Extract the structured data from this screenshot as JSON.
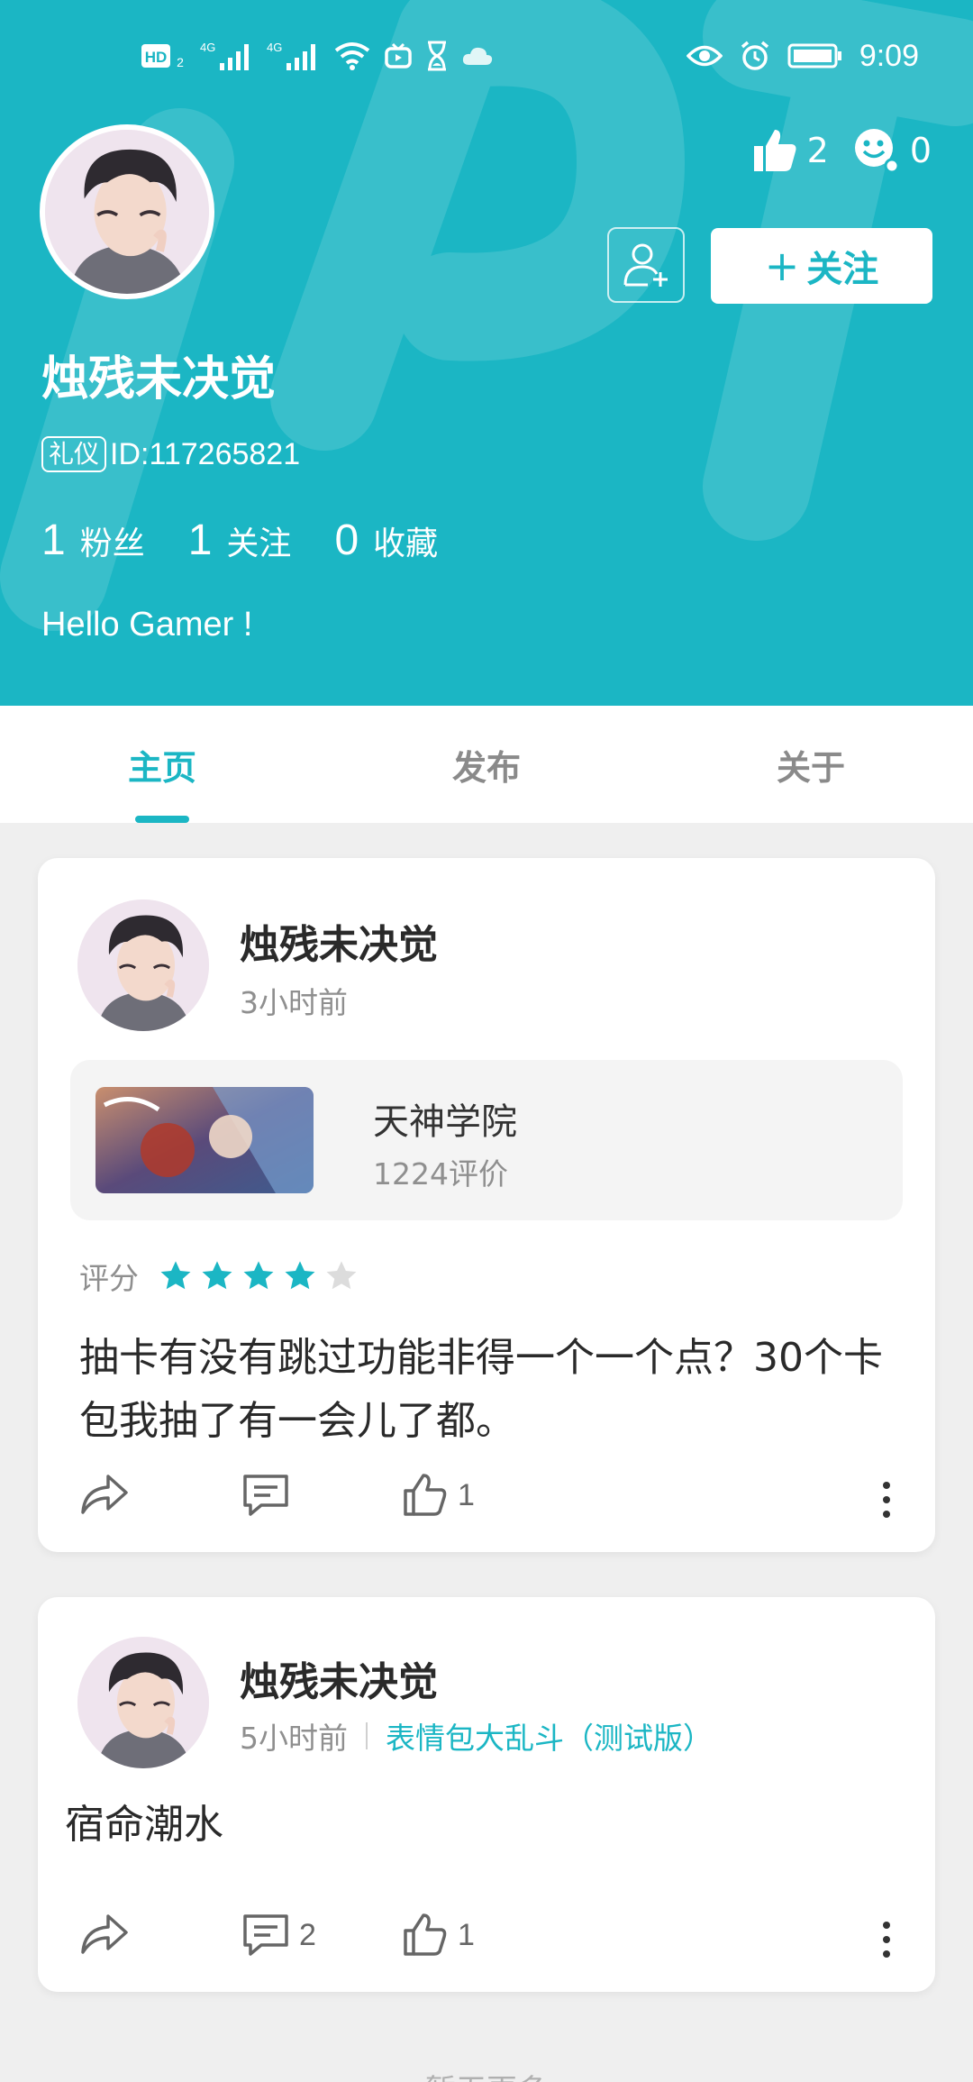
{
  "status_bar": {
    "network_labels": [
      "HD 2",
      "4G",
      "4G"
    ],
    "time": "9:09"
  },
  "header": {
    "likes_count": "2",
    "visitors_count": "0",
    "follow_label": "关注",
    "user_name": "烛残未决觉",
    "title_badge": "礼仪",
    "user_id": "ID:117265821",
    "stats": [
      {
        "num": "1",
        "label": "粉丝"
      },
      {
        "num": "1",
        "label": "关注"
      },
      {
        "num": "0",
        "label": "收藏"
      }
    ],
    "bio": "Hello Gamer !"
  },
  "tabs": [
    {
      "label": "主页",
      "active": true
    },
    {
      "label": "发布",
      "active": false
    },
    {
      "label": "关于",
      "active": false
    }
  ],
  "posts": [
    {
      "author": "烛残未决觉",
      "time": "3小时前",
      "game": {
        "title": "天神学院",
        "reviews": "1224评价"
      },
      "rating_label": "评分",
      "rating": 4,
      "rating_max": 5,
      "text": "抽卡有没有跳过功能非得一个一个点？30个卡包我抽了有一会儿了都。",
      "comment_count": "",
      "like_count": "1"
    },
    {
      "author": "烛残未决觉",
      "time": "5小时前",
      "game_link": "表情包大乱斗（测试版）",
      "text": "宿命潮水",
      "comment_count": "2",
      "like_count": "1"
    }
  ],
  "footer": "暂无更多",
  "colors": {
    "accent": "#1bb6c4",
    "star_empty": "#dcdcdc",
    "text_muted": "#8f8f8f"
  }
}
